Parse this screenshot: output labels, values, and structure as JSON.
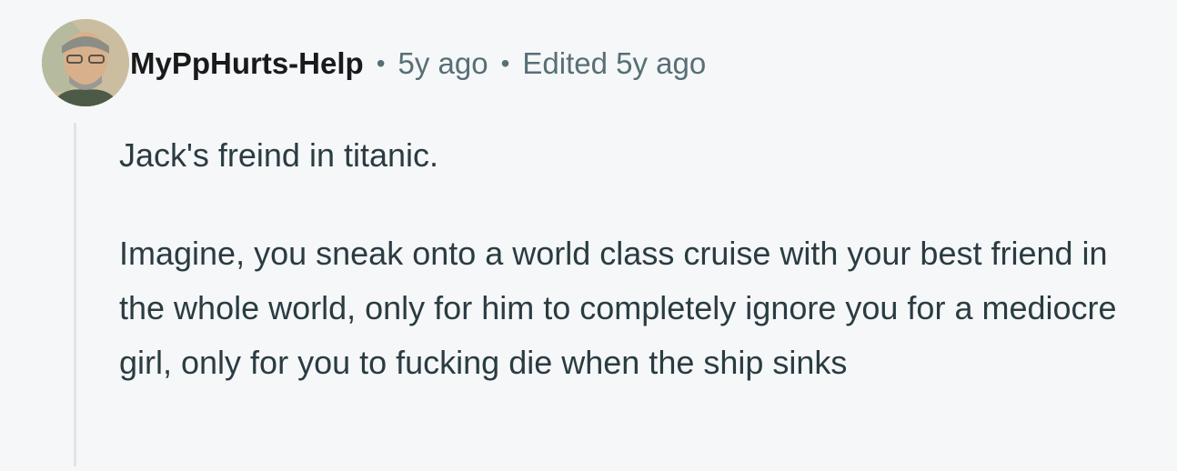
{
  "comment": {
    "author": "MyPpHurts-Help",
    "separator": "•",
    "time": "5y ago",
    "edited": "Edited 5y ago",
    "avatar_icon": "user-avatar-icon",
    "paragraphs": [
      "Jack's freind in titanic.",
      "Imagine, you sneak onto a world class cruise with your best friend in the whole world, only for him to completely ignore you for a mediocre girl, only for you to fucking die when the ship sinks"
    ]
  },
  "colors": {
    "background": "#f6f7f8",
    "meta_text": "#576f76",
    "body_text": "#2a3c42",
    "thread_line": "#e0e4e6"
  }
}
